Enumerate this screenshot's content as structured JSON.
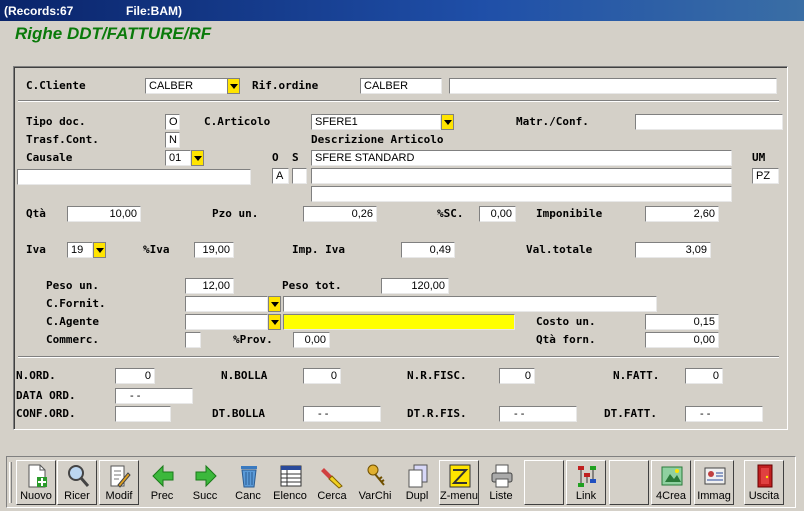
{
  "titlebar": {
    "records": "(Records:67",
    "file": "File:BAM)"
  },
  "heading": "Righe DDT/FATTURE/RF",
  "form": {
    "cliente_label": "C.Cliente",
    "cliente_value": "CALBER",
    "rif_ordine_label": "Rif.ordine",
    "rif_ordine_value": "CALBER",
    "rif_ordine_desc": "",
    "tipo_doc_label": "Tipo doc.",
    "tipo_doc_value": "O",
    "articolo_label": "C.Articolo",
    "articolo_value": "SFERE1",
    "matr_label": "Matr./Conf.",
    "matr_value": "",
    "trasf_label": "Trasf.Cont.",
    "trasf_value": "N",
    "descr_label": "Descrizione Articolo",
    "causale_label": "Causale",
    "causale_value": "01",
    "o_label": "O",
    "s_label": "S",
    "um_label": "UM",
    "descr1": "SFERE STANDARD",
    "descr2": "",
    "descr3": "",
    "causale_desc": "",
    "o_value": "A",
    "s_value": "",
    "um_value": "PZ",
    "qta_label": "Qtà",
    "qta_value": "10,00",
    "pzo_label": "Pzo un.",
    "pzo_value": "0,26",
    "sc_label": "%SC.",
    "sc_value": "0,00",
    "imponibile_label": "Imponibile",
    "imponibile_value": "2,60",
    "iva_label": "Iva",
    "iva_value": "19",
    "piva_label": "%Iva",
    "piva_value": "19,00",
    "imp_iva_label": "Imp. Iva",
    "imp_iva_value": "0,49",
    "val_totale_label": "Val.totale",
    "val_totale_value": "3,09",
    "peso_un_label": "Peso un.",
    "peso_un_value": "12,00",
    "peso_tot_label": "Peso tot.",
    "peso_tot_value": "120,00",
    "fornit_label": "C.Fornit.",
    "fornit_value": "",
    "fornit_desc": "",
    "agente_label": "C.Agente",
    "agente_value": "",
    "agente_desc": "",
    "costo_label": "Costo un.",
    "costo_value": "0,15",
    "commerc_label": "Commerc.",
    "commerc_value": "",
    "prov_label": "%Prov.",
    "prov_value": "0,00",
    "qta_forn_label": "Qtà forn.",
    "qta_forn_value": "0,00",
    "nord_label": "N.ORD.",
    "nord_value": "0",
    "nbolla_label": "N.BOLLA",
    "nbolla_value": "0",
    "nrfisc_label": "N.R.FISC.",
    "nrfisc_value": "0",
    "nfatt_label": "N.FATT.",
    "nfatt_value": "0",
    "data_ord_label": "DATA ORD.",
    "data_ord_value": "-   -",
    "conf_ord_label": "CONF.ORD.",
    "conf_ord_value": "",
    "dt_bolla_label": "DT.BOLLA",
    "dt_bolla_value": "-   -",
    "dt_rfis_label": "DT.R.FIS.",
    "dt_rfis_value": "-   -",
    "dt_fatt_label": "DT.FATT.",
    "dt_fatt_value": "-   -"
  },
  "toolbar": {
    "nuovo": "Nuovo",
    "ricer": "Ricer",
    "modif": "Modif",
    "prec": "Prec",
    "succ": "Succ",
    "canc": "Canc",
    "elenco": "Elenco",
    "cerca": "Cerca",
    "varchi": "VarChi",
    "dupl": "Dupl",
    "zmenu": "Z-menu",
    "liste": "Liste",
    "link": "Link",
    "crea4": "4Crea",
    "immag": "Immag",
    "uscita": "Uscita"
  },
  "colors": {
    "heading": "#0a7a0a",
    "highlight": "#ffff00",
    "title_bg": "#0a246a"
  }
}
